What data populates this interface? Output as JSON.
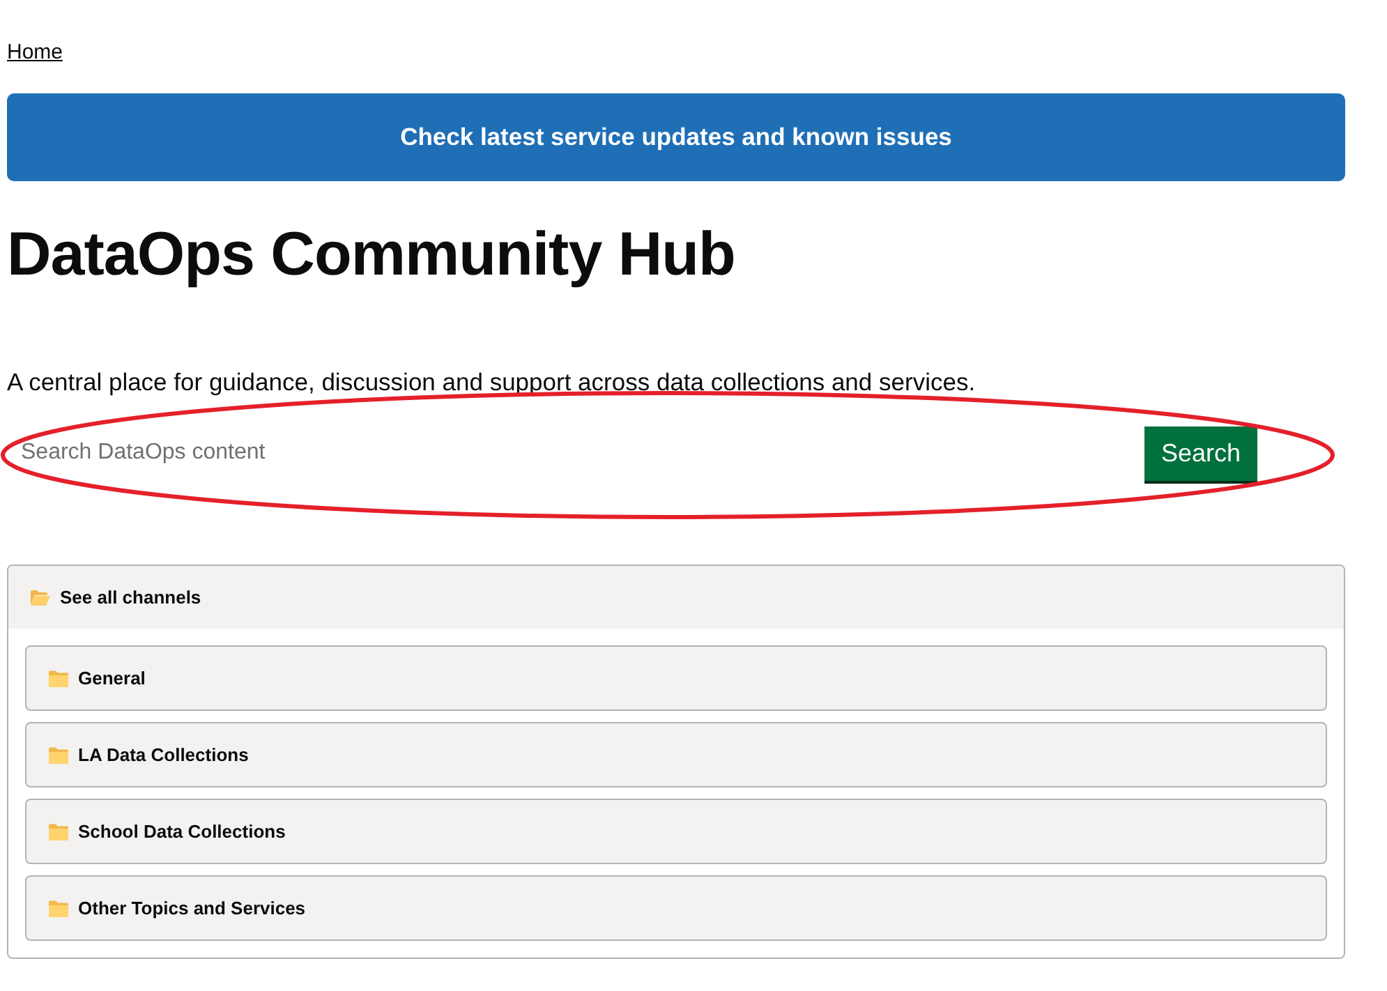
{
  "breadcrumb": {
    "label": "Home"
  },
  "banner": {
    "label": "Check latest service updates and known issues"
  },
  "page": {
    "title": "DataOps Community Hub",
    "description": "A central place for guidance, discussion and support across data collections and services."
  },
  "search": {
    "placeholder": "Search DataOps content",
    "button": "Search"
  },
  "annotation": {
    "kind": "ellipse"
  },
  "channels": {
    "header": "See all channels",
    "items": [
      {
        "label": "General"
      },
      {
        "label": "LA Data Collections"
      },
      {
        "label": "School Data Collections"
      },
      {
        "label": "Other Topics and Services"
      }
    ]
  }
}
